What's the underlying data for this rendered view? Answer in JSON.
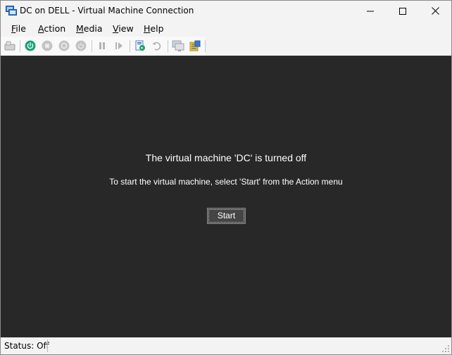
{
  "window": {
    "title": "DC on DELL - Virtual Machine Connection",
    "controls": [
      "minimize-icon",
      "maximize-icon",
      "close-icon"
    ]
  },
  "menu": {
    "items": [
      {
        "key": "F",
        "rest": "ile"
      },
      {
        "key": "A",
        "rest": "ction"
      },
      {
        "key": "M",
        "rest": "edia"
      },
      {
        "key": "V",
        "rest": "iew"
      },
      {
        "key": "H",
        "rest": "elp"
      }
    ]
  },
  "toolbar": {
    "icons": [
      "ctrl-alt-del-icon",
      "start-icon",
      "turn-off-icon",
      "shut-down-icon",
      "save-state-icon",
      "pause-icon",
      "resume-icon",
      "checkpoint-icon",
      "revert-icon",
      "enhanced-session-icon",
      "settings-icon"
    ]
  },
  "main": {
    "heading": "The virtual machine 'DC' is turned off",
    "instruction": "To start the virtual machine, select 'Start' from the Action menu",
    "start_label": "Start"
  },
  "status": {
    "text": "Status: Off"
  },
  "colors": {
    "content_bg": "#282828",
    "accent_green": "#1aa37a",
    "disabled_gray": "#a0a0a0"
  }
}
